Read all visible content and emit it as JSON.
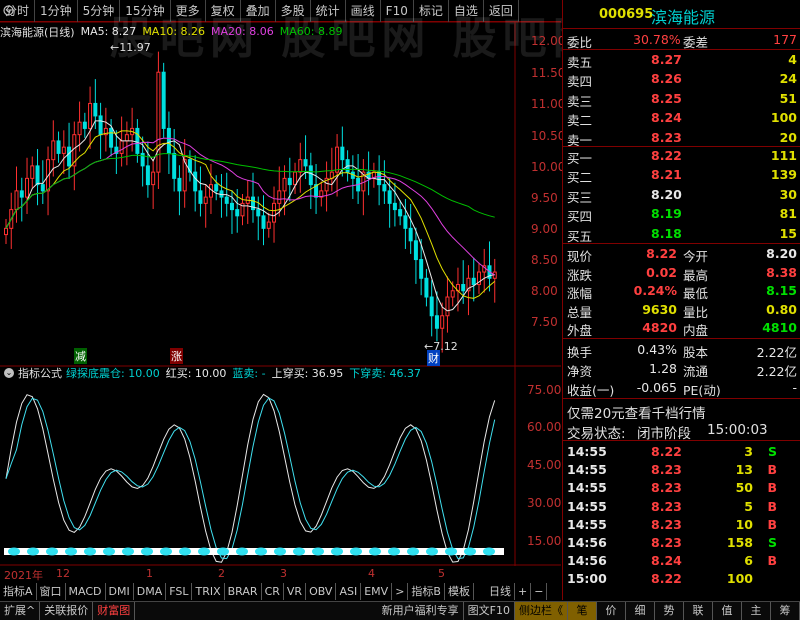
{
  "watermark": "股吧网 股吧网 股吧网",
  "menu": [
    "分时",
    "1分钟",
    "5分钟",
    "15分钟",
    "更多",
    "复权",
    "叠加",
    "多股",
    "统计",
    "画线",
    "F10",
    "标记",
    "自选",
    "返回"
  ],
  "main_header": {
    "title": "滨海能源(日线)",
    "ma5": "MA5: 8.27",
    "ma10": "MA10: 8.26",
    "ma20": "MA20: 8.06",
    "ma60": "MA60: 8.89"
  },
  "price_axis": [
    "12.00",
    "11.50",
    "11.00",
    "10.50",
    "10.00",
    "9.50",
    "9.00",
    "8.50",
    "8.00",
    "7.50"
  ],
  "annotations": {
    "high": "11.97",
    "low": "7.12",
    "jian": "减",
    "zhang": "涨",
    "cai": "财"
  },
  "indicator_header": {
    "name": "指标公式",
    "formula": "绿探底震仓: 10.00",
    "red_buy": "红买: 10.00",
    "blue_sell": "蓝卖: -",
    "up_cross": "上穿买: 36.95",
    "down_cross": "下穿卖: 46.37"
  },
  "indicator_axis": [
    "75.00",
    "60.00",
    "45.00",
    "30.00",
    "15.00"
  ],
  "date_axis": [
    "2021年",
    "12",
    "1",
    "2",
    "3",
    "4",
    "5"
  ],
  "tabs": [
    "指标A",
    "窗口",
    "MACD",
    "DMI",
    "DMA",
    "FSL",
    "TRIX",
    "BRAR",
    "CR",
    "VR",
    "OBV",
    "ASI",
    "EMV",
    ">",
    "指标B",
    "模板",
    "日线",
    "+",
    "−"
  ],
  "bottom_tabs": [
    "扩展^",
    "关联报价",
    "财富图",
    "新用户福利专享",
    "图文F10",
    "侧边栏《"
  ],
  "right_bottom_tabs": [
    "笔",
    "价",
    "细",
    "势",
    "联",
    "值",
    "主",
    "筹"
  ],
  "stock": {
    "code": "000695",
    "name": "滨海能源"
  },
  "order_book": {
    "weibi_label": "委比",
    "weibi": "30.78%",
    "weicha_label": "委差",
    "weicha": "177",
    "asks": [
      {
        "label": "卖五",
        "price": "8.27",
        "vol": "4"
      },
      {
        "label": "卖四",
        "price": "8.26",
        "vol": "24"
      },
      {
        "label": "卖三",
        "price": "8.25",
        "vol": "51"
      },
      {
        "label": "卖二",
        "price": "8.24",
        "vol": "100"
      },
      {
        "label": "卖一",
        "price": "8.23",
        "vol": "20"
      }
    ],
    "bids": [
      {
        "label": "买一",
        "price": "8.22",
        "vol": "111"
      },
      {
        "label": "买二",
        "price": "8.21",
        "vol": "139"
      },
      {
        "label": "买三",
        "price": "8.20",
        "vol": "30"
      },
      {
        "label": "买四",
        "price": "8.19",
        "vol": "81"
      },
      {
        "label": "买五",
        "price": "8.18",
        "vol": "15"
      }
    ]
  },
  "quote": [
    {
      "l1": "现价",
      "v1": "8.22",
      "l2": "今开",
      "v2": "8.20"
    },
    {
      "l1": "涨跌",
      "v1": "0.02",
      "l2": "最高",
      "v2": "8.38"
    },
    {
      "l1": "涨幅",
      "v1": "0.24%",
      "l2": "最低",
      "v2": "8.15"
    },
    {
      "l1": "总量",
      "v1": "9630",
      "l2": "量比",
      "v2": "0.80"
    },
    {
      "l1": "外盘",
      "v1": "4820",
      "l2": "内盘",
      "v2": "4810"
    }
  ],
  "fundamentals": [
    {
      "l1": "换手",
      "v1": "0.43%",
      "l2": "股本",
      "v2": "2.22亿"
    },
    {
      "l1": "净资",
      "v1": "1.28",
      "l2": "流通",
      "v2": "2.22亿"
    },
    {
      "l1": "收益(一)",
      "v1": "-0.065",
      "l2": "PE(动)",
      "v2": "-"
    }
  ],
  "promo": "仅需20元查看千档行情",
  "trade_status": {
    "label": "交易状态:",
    "value": "闭市阶段",
    "time": "15:00:03"
  },
  "ticks": [
    {
      "t": "14:55",
      "p": "8.22",
      "v": "3",
      "s": "S"
    },
    {
      "t": "14:55",
      "p": "8.23",
      "v": "13",
      "s": "B"
    },
    {
      "t": "14:55",
      "p": "8.23",
      "v": "50",
      "s": "B"
    },
    {
      "t": "14:55",
      "p": "8.23",
      "v": "5",
      "s": "B"
    },
    {
      "t": "14:55",
      "p": "8.23",
      "v": "10",
      "s": "B"
    },
    {
      "t": "14:56",
      "p": "8.23",
      "v": "158",
      "s": "S"
    },
    {
      "t": "14:56",
      "p": "8.24",
      "v": "6",
      "s": "B"
    },
    {
      "t": "15:00",
      "p": "8.22",
      "v": "100",
      "s": ""
    }
  ],
  "colors": {
    "up": "#ff3030",
    "down": "#00e0e0",
    "ma5": "#e8e8e8",
    "ma10": "#e0e000",
    "ma20": "#e040e0",
    "ma60": "#00c000",
    "border": "#800000"
  }
}
